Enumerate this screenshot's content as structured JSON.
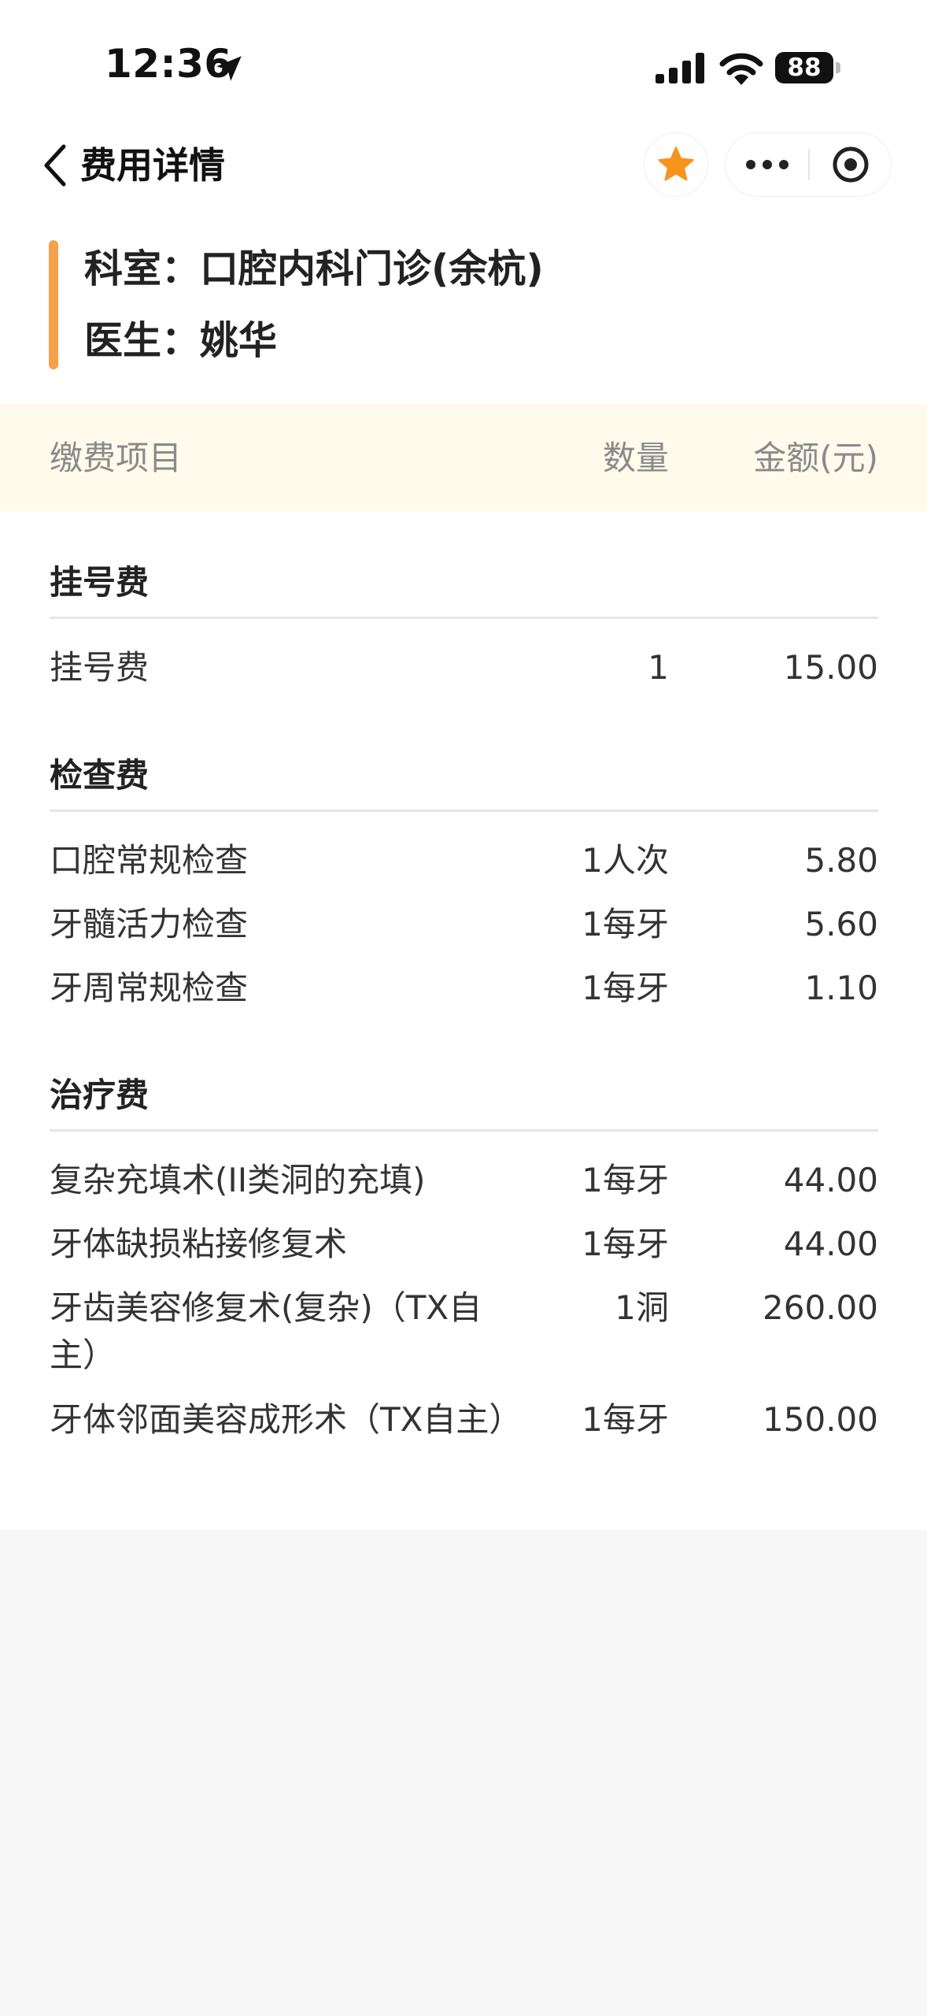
{
  "status_bar": {
    "time": "12:36",
    "battery": "88",
    "icons": [
      "location-arrow-icon",
      "signal-icon",
      "wifi-icon",
      "battery-icon"
    ]
  },
  "nav": {
    "title": "费用详情",
    "icons": [
      "chevron-left-icon",
      "star-icon",
      "more-dots-icon",
      "close-circle-icon"
    ],
    "accent_color": "#f7941d"
  },
  "info": {
    "department": "科室：口腔内科门诊(余杭)",
    "doctor": "医生：姚华",
    "bar_color": "#f5a04a"
  },
  "table": {
    "headers": {
      "item": "缴费项目",
      "qty": "数量",
      "amount": "金额(元)"
    },
    "sections": [
      {
        "title": "挂号费",
        "rows": [
          {
            "name": "挂号费",
            "qty": "1",
            "amount": "15.00"
          }
        ]
      },
      {
        "title": "检查费",
        "rows": [
          {
            "name": "口腔常规检查",
            "qty": "1人次",
            "amount": "5.80"
          },
          {
            "name": "牙髓活力检查",
            "qty": "1每牙",
            "amount": "5.60"
          },
          {
            "name": "牙周常规检查",
            "qty": "1每牙",
            "amount": "1.10"
          }
        ]
      },
      {
        "title": "治疗费",
        "rows": [
          {
            "name": "复杂充填术(II类洞的充填)",
            "qty": "1每牙",
            "amount": "44.00"
          },
          {
            "name": "牙体缺损粘接修复术",
            "qty": "1每牙",
            "amount": "44.00"
          },
          {
            "name": "牙齿美容修复术(复杂)（TX自主）",
            "qty": "1洞",
            "amount": "260.00"
          },
          {
            "name": "牙体邻面美容成形术（TX自主）",
            "qty": "1每牙",
            "amount": "150.00"
          }
        ]
      }
    ]
  }
}
